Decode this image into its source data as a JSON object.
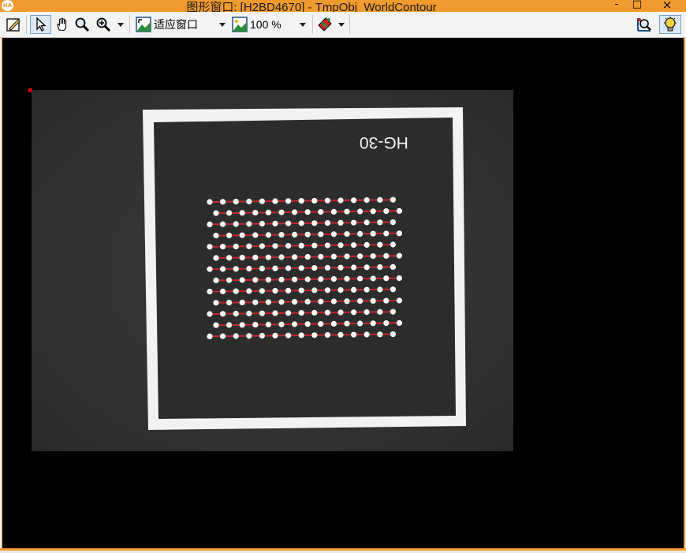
{
  "window": {
    "title": "图形窗口: [H2BD4670] - TmpObj_WorldContour",
    "app_badge": "HA",
    "minimize": "-",
    "maximize": "□",
    "close": "×"
  },
  "toolbar": {
    "fit_label": "适应窗口",
    "zoom_label": "100 %"
  },
  "image": {
    "card_text": "HG-30",
    "dot_grid_rows": 13,
    "dot_grid_cols": 15,
    "contour_color": "#c0262c",
    "dot_color": "#ffffff"
  },
  "colors": {
    "frame": "#f19a2e",
    "canvas": "#000000",
    "origin_marker": "#e00000"
  }
}
